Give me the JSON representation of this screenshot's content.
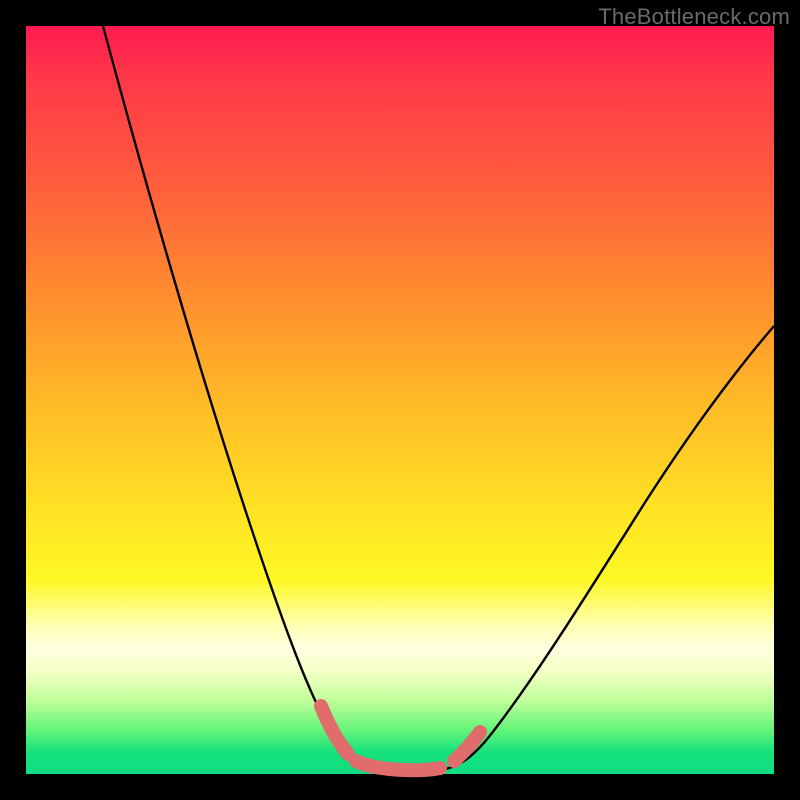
{
  "watermark": "TheBottleneck.com",
  "colors": {
    "frame": "#000000",
    "curve": "#000000",
    "marker": "#e06c6c",
    "gradient_top": "#ff1a52",
    "gradient_mid": "#ffe324",
    "gradient_bottom": "#0fdc84"
  },
  "chart_data": {
    "type": "line",
    "title": "",
    "xlabel": "",
    "ylabel": "",
    "xlim": [
      0,
      100
    ],
    "ylim": [
      0,
      100
    ],
    "grid": false,
    "legend": false,
    "note": "Bottleneck-style V curve. y = estimated bottleneck percentage (100 at top, 0 at bottom). Minimum plateau near 0% around x≈43–55. Left branch starts near y≈100 at x≈10 and descends steeply; right branch rises to y≈55 at x=100.",
    "series": [
      {
        "name": "bottleneck-curve",
        "x": [
          10,
          14,
          18,
          22,
          26,
          30,
          33,
          36,
          39,
          41,
          43,
          46,
          50,
          54,
          56,
          60,
          64,
          70,
          76,
          82,
          88,
          94,
          100
        ],
        "y": [
          100,
          88,
          76,
          64,
          52,
          41,
          32,
          24,
          16,
          9,
          3,
          1,
          0.5,
          1,
          3,
          8,
          14,
          22,
          30,
          37,
          44,
          50,
          55
        ]
      }
    ],
    "markers": {
      "name": "highlighted-segment",
      "color": "#e06c6c",
      "thickness_px": 12,
      "segments": [
        {
          "x": [
            39,
            41,
            43
          ],
          "y": [
            16,
            9,
            3
          ]
        },
        {
          "x": [
            43,
            46,
            50,
            54,
            56
          ],
          "y": [
            3,
            1,
            0.5,
            1,
            3
          ]
        },
        {
          "x": [
            56,
            59
          ],
          "y": [
            3,
            7
          ]
        }
      ]
    }
  }
}
